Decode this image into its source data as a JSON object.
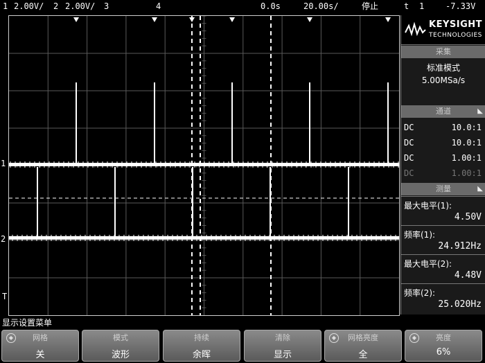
{
  "status_bar": {
    "ch1_num": "1",
    "ch1_scale": "2.00V/",
    "ch2_num": "2",
    "ch2_scale": "2.00V/",
    "ch3_num": "3",
    "ch4_num": "4",
    "delay": "0.0s",
    "timebase": "20.00s/",
    "run_state": "停止",
    "trigger_symbol": "t",
    "trigger_source": "1",
    "trigger_level": "-7.33V"
  },
  "screen": {
    "ch1_marker": "1",
    "ch2_marker": "2",
    "trigger_marker": "T",
    "ch1_level_fraction": 0.5,
    "ch2_level_fraction": 0.745,
    "trace_color": "#ffffff",
    "grid_color": "#5a5a5a"
  },
  "panel": {
    "brand": "KEYSIGHT",
    "brand_sub": "TECHNOLOGIES",
    "acq_header": "采集",
    "acq_mode": "标准模式",
    "acq_rate": "5.00MSa/s",
    "channel_header": "通道",
    "channels": [
      {
        "coupling": "DC",
        "ratio": "10.0:1",
        "active": true
      },
      {
        "coupling": "DC",
        "ratio": "10.0:1",
        "active": true
      },
      {
        "coupling": "DC",
        "ratio": "1.00:1",
        "active": true
      },
      {
        "coupling": "DC",
        "ratio": "1.00:1",
        "active": false
      }
    ],
    "meas_header": "测量",
    "measurements": [
      {
        "name": "最大电平(1):",
        "value": "4.50V"
      },
      {
        "name": "频率(1):",
        "value": "24.912Hz"
      },
      {
        "name": "最大电平(2):",
        "value": "4.48V"
      },
      {
        "name": "频率(2):",
        "value": "25.020Hz"
      }
    ]
  },
  "menu": {
    "title": "显示设置菜单",
    "softkeys": [
      {
        "head": "网格",
        "value": "关"
      },
      {
        "head": "模式",
        "value": "波形"
      },
      {
        "head": "持续",
        "value": "余晖"
      },
      {
        "head": "清除",
        "value": "显示"
      },
      {
        "head": "网格亮度",
        "value": "全"
      },
      {
        "head": "亮度",
        "value": "6%"
      }
    ]
  }
}
